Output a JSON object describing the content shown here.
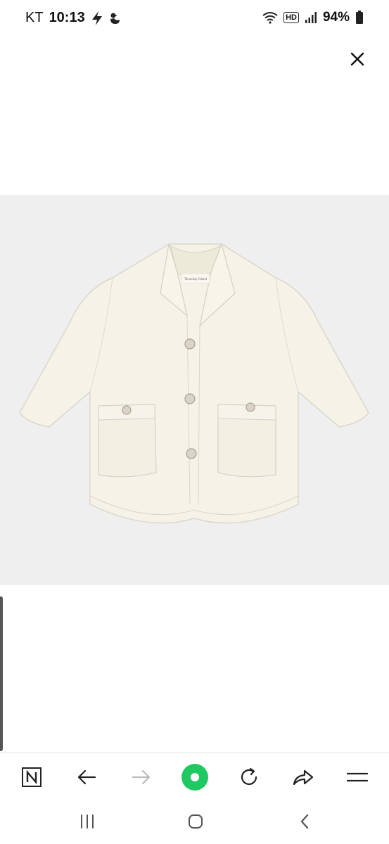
{
  "status_bar": {
    "carrier": "KT",
    "time": "10:13",
    "network_badge": "HD",
    "battery": "94%"
  },
  "close_button": {
    "icon": "close-icon"
  },
  "product_image": {
    "description_icon": "shirt-jacket-image",
    "background": "#efefef",
    "garment_color": "#f5f2e8",
    "label_brand": "Thursday Island"
  },
  "toolbar": {
    "items": [
      "naver-n-icon",
      "back-arrow-icon",
      "forward-arrow-icon",
      "green-dot-button",
      "refresh-icon",
      "share-icon",
      "menu-icon"
    ],
    "accent": "#1ec962"
  },
  "nav_bar": {
    "items": [
      "recent-apps-icon",
      "home-icon",
      "back-chevron-icon"
    ]
  }
}
